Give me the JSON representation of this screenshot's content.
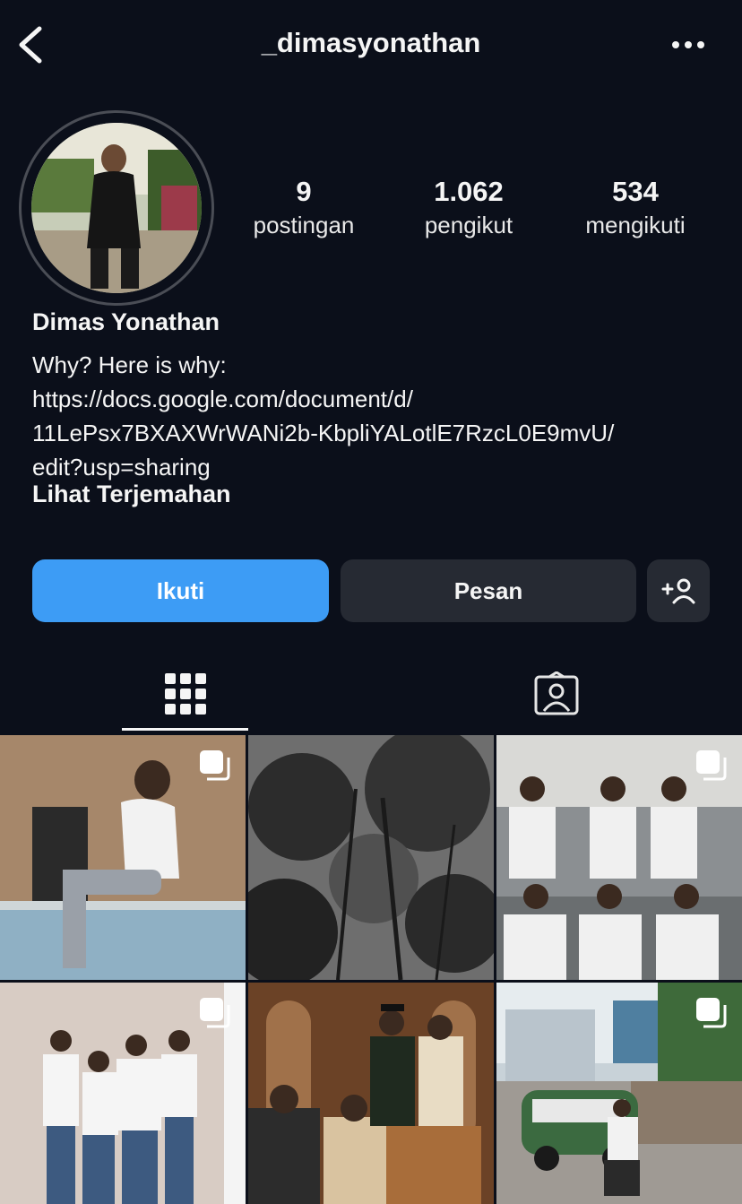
{
  "header": {
    "username": "_dimasyonathan",
    "back_icon": "chevron-left-icon",
    "more_icon": "more-horizontal-icon"
  },
  "profile": {
    "avatar_icon": "profile-photo",
    "stats": [
      {
        "value": "9",
        "label": "postingan"
      },
      {
        "value": "1.062",
        "label": "pengikut"
      },
      {
        "value": "534",
        "label": "mengikuti"
      }
    ],
    "display_name": "Dimas Yonathan",
    "bio_lines": [
      "Why? Here is why:",
      "https://docs.google.com/document/d/",
      "11LePsx7BXAXWrWANi2b-KbpliYALotlE7RzcL0E9mvU/",
      "edit?usp=sharing"
    ],
    "translate_label": "Lihat Terjemahan"
  },
  "actions": {
    "follow_label": "Ikuti",
    "message_label": "Pesan",
    "add_person_icon": "add-person-icon"
  },
  "tabs": [
    {
      "name": "posts-grid",
      "icon": "grid-icon",
      "active": true
    },
    {
      "name": "tagged",
      "icon": "tagged-person-icon",
      "active": false
    }
  ],
  "posts": [
    {
      "desc": "photo",
      "multi": true
    },
    {
      "desc": "photo",
      "multi": false
    },
    {
      "desc": "photo",
      "multi": true
    },
    {
      "desc": "photo",
      "multi": true
    },
    {
      "desc": "photo",
      "multi": false
    },
    {
      "desc": "photo",
      "multi": true
    }
  ],
  "colors": {
    "background": "#0b0f1a",
    "follow_button": "#3d9cf5",
    "secondary_button": "#262a33"
  }
}
